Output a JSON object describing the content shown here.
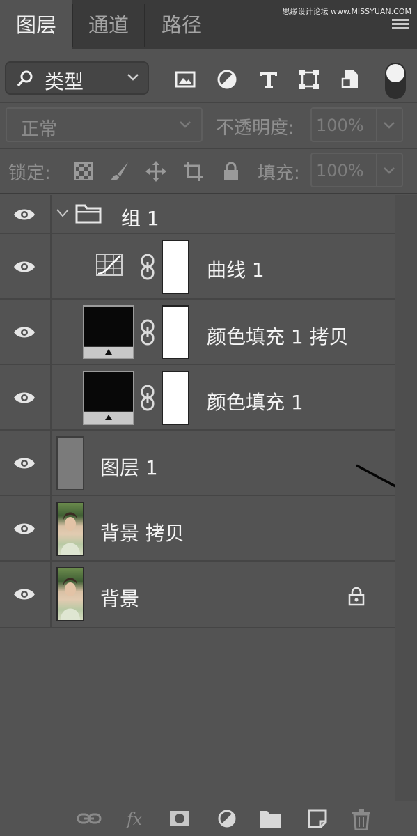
{
  "watermark": "思缘设计论坛 www.MISSYUAN.COM",
  "tabs": [
    {
      "label": "图层",
      "active": true
    },
    {
      "label": "通道",
      "active": false
    },
    {
      "label": "路径",
      "active": false
    }
  ],
  "filter": {
    "kind_label": "类型",
    "icons": [
      "image-filter-icon",
      "adjustment-filter-icon",
      "type-filter-icon",
      "shape-filter-icon",
      "smart-object-filter-icon"
    ]
  },
  "blend": {
    "mode": "正常",
    "opacity_label": "不透明度:",
    "opacity_value": "100%"
  },
  "lock": {
    "label": "锁定:",
    "fill_label": "填充:",
    "fill_value": "100%"
  },
  "layers": [
    {
      "name": "组 1",
      "type": "group",
      "expanded": true,
      "visible": true
    },
    {
      "name": "曲线 1",
      "type": "curves-adjustment",
      "visible": true
    },
    {
      "name": "颜色填充 1 拷贝",
      "type": "solid-color-fill",
      "visible": true
    },
    {
      "name": "颜色填充 1",
      "type": "solid-color-fill",
      "visible": true
    },
    {
      "name": "图层 1",
      "type": "pixel",
      "visible": true
    },
    {
      "name": "背景 拷贝",
      "type": "pixel",
      "visible": true
    },
    {
      "name": "背景",
      "type": "background",
      "visible": true,
      "locked": true
    }
  ],
  "colors": {
    "panel": "#535353",
    "tabbar": "#3a3a3a",
    "text": "#f4f4f4"
  }
}
